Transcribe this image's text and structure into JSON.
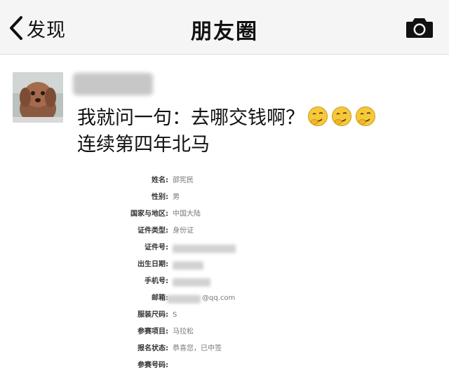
{
  "navbar": {
    "back_label": "发现",
    "title": "朋友圈"
  },
  "post": {
    "line1": "我就问一句：去哪交钱啊？",
    "line2": "连续第四年北马",
    "emoji_count": 3
  },
  "form": {
    "rows": [
      {
        "label": "姓名:",
        "value": "邵宪民"
      },
      {
        "label": "性别:",
        "value": "男"
      },
      {
        "label": "国家与地区:",
        "value": "中国大陆"
      },
      {
        "label": "证件类型:",
        "value": "身份证"
      },
      {
        "label": "证件号:",
        "value": ""
      },
      {
        "label": "出生日期:",
        "value": ""
      },
      {
        "label": "手机号:",
        "value": ""
      },
      {
        "label": "邮箱:",
        "value": "@qq.com"
      },
      {
        "label": "服装尺码:",
        "value": "S"
      },
      {
        "label": "参赛项目:",
        "value": "马拉松"
      },
      {
        "label": "报名状态:",
        "value": "恭喜您，已中签"
      },
      {
        "label": "参赛号码:",
        "value": ""
      }
    ]
  },
  "colors": {
    "navbar_bg": "#f5f5f6",
    "emoji_yellow": "#f6c93b"
  }
}
